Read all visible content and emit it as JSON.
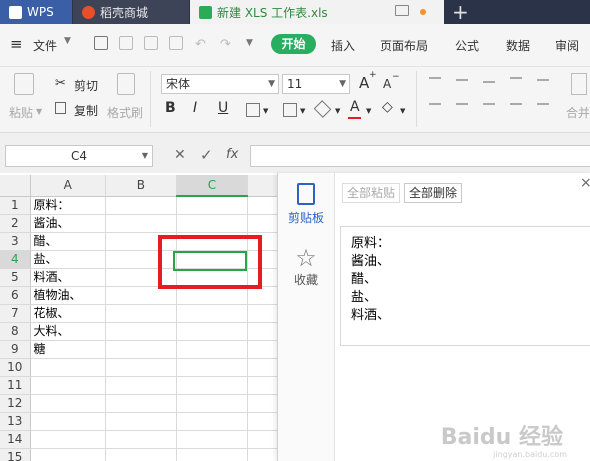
{
  "tabs": {
    "wps": "WPS",
    "shop": "稻壳商城",
    "doc": "新建 XLS 工作表.xls",
    "new_tab": "+"
  },
  "menubar": {
    "hamburger": "≡",
    "file": "文件",
    "items": [
      "开始",
      "插入",
      "页面布局",
      "公式",
      "数据",
      "审阅"
    ]
  },
  "ribbon": {
    "paste": "粘贴",
    "cut": "剪切",
    "copy": "复制",
    "format_painter": "格式刷",
    "font_name": "宋体",
    "font_size": "11",
    "grow_font": "A",
    "shrink_font": "A",
    "bold": "B",
    "italic": "I",
    "underline": "U",
    "font_color": "A",
    "merge": "合并"
  },
  "formula_bar": {
    "name_box": "C4",
    "cancel": "✕",
    "confirm": "✓",
    "fx": "fx"
  },
  "sheet": {
    "columns": [
      "A",
      "B",
      "C"
    ],
    "selected_column": "C",
    "selected_row": "4",
    "row_numbers": [
      "1",
      "2",
      "3",
      "4",
      "5",
      "6",
      "7",
      "8",
      "9",
      "10",
      "11",
      "12",
      "13",
      "14",
      "15"
    ],
    "col_a_values": [
      "原料：",
      "酱油、",
      "醋、",
      "盐、",
      "料酒、",
      "植物油、",
      "花椒、",
      "大料、",
      "糖",
      "",
      "",
      "",
      "",
      "",
      ""
    ]
  },
  "clipboard_panel": {
    "nav_clipboard": "剪贴板",
    "nav_favorites": "收藏",
    "paste_all": "全部粘贴",
    "delete_all": "全部删除",
    "item_lines": [
      "原料：",
      "酱油、",
      "醋、",
      "盐、",
      "料酒、"
    ],
    "close": "×"
  },
  "watermark": {
    "text": "Baidu 经验",
    "sub": "jingyan.baidu.com"
  },
  "colors": {
    "titlebar": "#2b3348",
    "accent_green": "#27ae60",
    "highlight_red": "#e51c23",
    "link_blue": "#2b63c1"
  }
}
